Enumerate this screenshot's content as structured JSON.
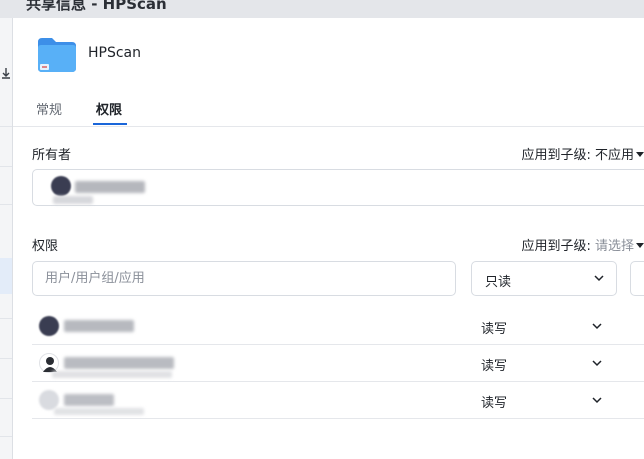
{
  "window": {
    "title": "共享信息 - HPScan"
  },
  "file": {
    "name": "HPScan",
    "icon": "folder-icon"
  },
  "tabs": [
    {
      "label": "常规",
      "active": false
    },
    {
      "label": "权限",
      "active": true
    }
  ],
  "owner": {
    "section_label": "所有者",
    "apply_label": "应用到子级:",
    "apply_value": "不应用",
    "user": {
      "name": "[blurred]"
    }
  },
  "permissions": {
    "section_label": "权限",
    "apply_label": "应用到子级:",
    "apply_value": "请选择",
    "search_placeholder": "用户/用户组/应用",
    "default_permission": "只读",
    "entries": [
      {
        "name": "[blurred]",
        "permission": "读写"
      },
      {
        "name": "[blurred]",
        "permission": "读写"
      },
      {
        "name": "[blurred]",
        "permission": "读写"
      }
    ]
  },
  "colors": {
    "accent": "#1a66d9",
    "border": "#d8dce2",
    "folder": "#4aa3f5"
  }
}
